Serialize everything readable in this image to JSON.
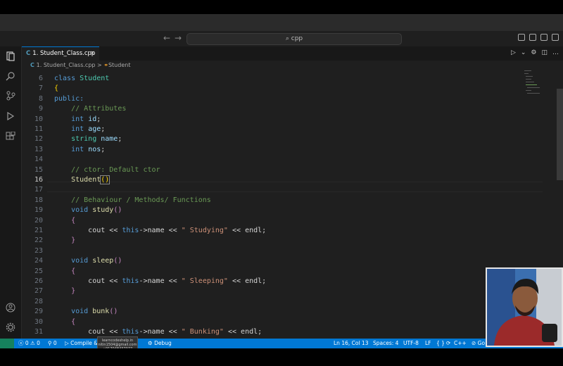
{
  "search": {
    "value": "cpp"
  },
  "tab": {
    "filename": "1. Student_Class.cpp"
  },
  "breadcrumb": {
    "file": "1. Student_Class.cpp",
    "separator": ">",
    "symbol": "Student"
  },
  "code": {
    "current_line": 16,
    "lines": [
      {
        "n": "6"
      },
      {
        "n": "7"
      },
      {
        "n": "8"
      },
      {
        "n": "9"
      },
      {
        "n": "10"
      },
      {
        "n": "11"
      },
      {
        "n": "12"
      },
      {
        "n": "13"
      },
      {
        "n": "14"
      },
      {
        "n": "15"
      },
      {
        "n": "16"
      },
      {
        "n": "17"
      },
      {
        "n": "18"
      },
      {
        "n": "19"
      },
      {
        "n": "20"
      },
      {
        "n": "21"
      },
      {
        "n": "22"
      },
      {
        "n": "23"
      },
      {
        "n": "24"
      },
      {
        "n": "25"
      },
      {
        "n": "26"
      },
      {
        "n": "27"
      },
      {
        "n": "28"
      },
      {
        "n": "29"
      },
      {
        "n": "30"
      },
      {
        "n": "31"
      }
    ],
    "tokens": {
      "class_kw": "class",
      "class_name": "Student",
      "brace_open": "{",
      "brace_close": "}",
      "public_kw": "public:",
      "c_attrs": "// Attributes",
      "int_kw": "int",
      "string_kw": "string",
      "id": "id",
      "age": "age",
      "name": "name",
      "nos": "nos",
      "semi": ";",
      "c_ctor": "// ctor: Default ctor",
      "ctor_name": "Student",
      "parens": "()",
      "c_behaviour": "// Behaviour / Methods/ Functions",
      "void_kw": "void",
      "study": "study",
      "sleep": "sleep",
      "bunk": "bunk",
      "cout": "cout",
      "shl": "<<",
      "this_kw": "this",
      "arrow": "->",
      "endl": "endl",
      "s_study": "\" Studying\"",
      "s_sleep": "\" Sleeping\"",
      "s_bunk": "\" Bunking\""
    }
  },
  "statusbar": {
    "errors": "0",
    "warnings": "0",
    "ports": "0",
    "compile": "Compile &",
    "debug": "Debug",
    "position": "Ln 16, Col 13",
    "spaces": "Spaces: 4",
    "encoding": "UTF-8",
    "eol": "LF",
    "braces": "{ }",
    "language": "C++",
    "go_live": "Go"
  },
  "tooltip": {
    "line1": "learncodeshelp.in",
    "line2": "nitin1504@gmail.com",
    "line3": "+917048437077"
  },
  "colors": {
    "accent": "#0078d4",
    "editor_bg": "#1f1f1f",
    "statusbar": "#0078d4"
  }
}
